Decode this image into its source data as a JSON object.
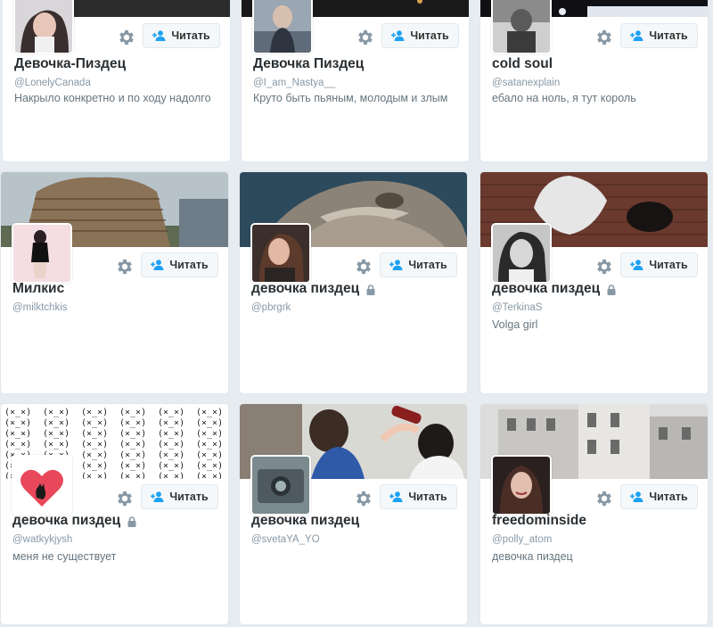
{
  "colors": {
    "page_background": "#e6ecf0",
    "card_background": "#ffffff",
    "name_text": "#292f33",
    "handle_text": "#8899a6",
    "bio_text": "#66757f",
    "follow_icon": "#1da1f2"
  },
  "cards": [
    {
      "name": "Девочка-Пиздец",
      "handle": "@LonelyCanada",
      "bio": "Накрыло конкретно и по ходу надолго",
      "follow_label": "Читать",
      "protected": false
    },
    {
      "name": "Девочка Пиздец",
      "handle": "@I_am_Nastya__",
      "bio": "Круто быть пьяным, молодым и злым",
      "follow_label": "Читать",
      "protected": false
    },
    {
      "name": "cold soul",
      "handle": "@satanexplain",
      "bio": "ебало на ноль, я тут король",
      "follow_label": "Читать",
      "protected": false
    },
    {
      "name": "Милкис",
      "handle": "@milktchkis",
      "bio": "",
      "follow_label": "Читать",
      "protected": false
    },
    {
      "name": "девочка пиздец",
      "handle": "@pbrgrk",
      "bio": "",
      "follow_label": "Читать",
      "protected": true
    },
    {
      "name": "девочка пиздец",
      "handle": "@TerkinaS",
      "bio": "Volga girl",
      "follow_label": "Читать",
      "protected": true
    },
    {
      "name": "девочка пиздец",
      "handle": "@watkykjysh",
      "bio": "меня не существует",
      "follow_label": "Читать",
      "protected": true
    },
    {
      "name": "девочка пиздец",
      "handle": "@svetaYA_YO",
      "bio": "",
      "follow_label": "Читать",
      "protected": false
    },
    {
      "name": "freedominside",
      "handle": "@polly_atom",
      "bio": "девочка пиздец",
      "follow_label": "Читать",
      "protected": false
    }
  ],
  "banner_7_text": "(×_×)"
}
